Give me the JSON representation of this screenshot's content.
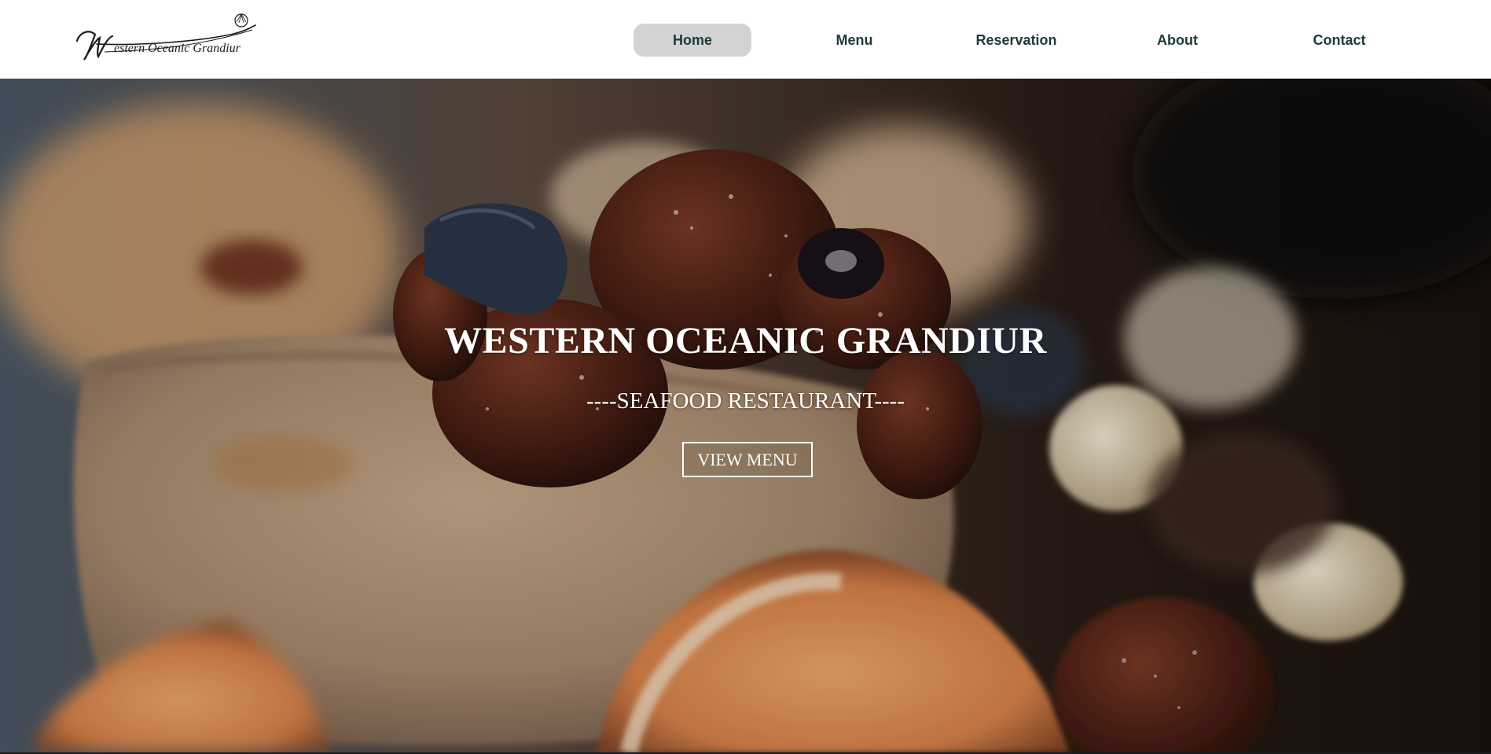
{
  "logo": {
    "text": "Western Oceanic Grandiur",
    "icon": "shell-icon"
  },
  "nav": {
    "items": [
      {
        "label": "Home",
        "active": true
      },
      {
        "label": "Menu",
        "active": false
      },
      {
        "label": "Reservation",
        "active": false
      },
      {
        "label": "About",
        "active": false
      },
      {
        "label": "Contact",
        "active": false
      }
    ]
  },
  "hero": {
    "title": "WESTERN OCEANIC GRANDIUR",
    "subtitle": "----SEAFOOD RESTAURANT----",
    "button_label": "VIEW MENU"
  },
  "colors": {
    "nav_text": "#1c3a3a",
    "nav_active_bg": "#d3d3d3",
    "hero_text": "#ffffff"
  }
}
